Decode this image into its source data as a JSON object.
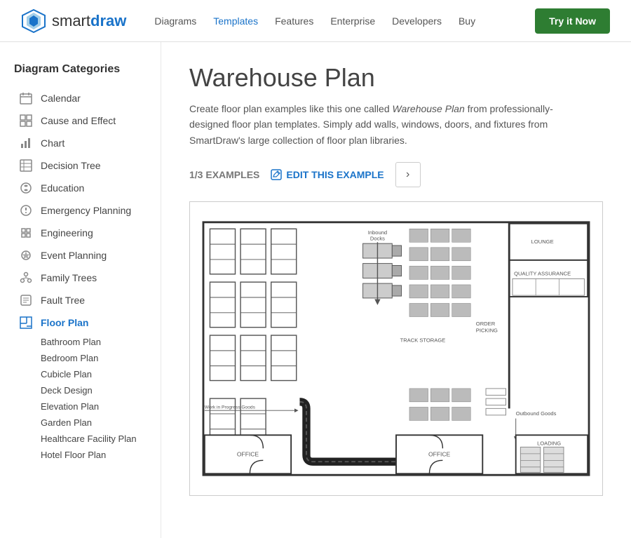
{
  "header": {
    "logo_smart": "smart",
    "logo_draw": "draw",
    "nav": [
      {
        "label": "Diagrams",
        "active": false
      },
      {
        "label": "Templates",
        "active": true
      },
      {
        "label": "Features",
        "active": false
      },
      {
        "label": "Enterprise",
        "active": false
      },
      {
        "label": "Developers",
        "active": false
      },
      {
        "label": "Buy",
        "active": false
      }
    ],
    "try_button": "Try it Now"
  },
  "sidebar": {
    "title": "Diagram Categories",
    "items": [
      {
        "label": "Calendar",
        "icon": "▦",
        "active": false
      },
      {
        "label": "Cause and Effect",
        "icon": "⊞",
        "active": false
      },
      {
        "label": "Chart",
        "icon": "▦",
        "active": false
      },
      {
        "label": "Decision Tree",
        "icon": "⊟",
        "active": false
      },
      {
        "label": "Education",
        "icon": "✿",
        "active": false
      },
      {
        "label": "Emergency Planning",
        "icon": "⊛",
        "active": false
      },
      {
        "label": "Engineering",
        "icon": "▦",
        "active": false
      },
      {
        "label": "Event Planning",
        "icon": "✿",
        "active": false
      },
      {
        "label": "Family Trees",
        "icon": "⊞",
        "active": false
      },
      {
        "label": "Fault Tree",
        "icon": "▣",
        "active": false
      },
      {
        "label": "Floor Plan",
        "icon": "◩",
        "active": true
      }
    ],
    "sub_items": [
      "Bathroom Plan",
      "Bedroom Plan",
      "Cubicle Plan",
      "Deck Design",
      "Elevation Plan",
      "Garden Plan",
      "Healthcare Facility Plan",
      "Hotel Floor Plan"
    ]
  },
  "content": {
    "title": "Warehouse Plan",
    "description": "Create floor plan examples like this one called Warehouse Plan from professionally-designed floor plan templates. Simply add walls, windows, doors, and fixtures from SmartDraw's large collection of floor plan libraries.",
    "example_counter": "1/3 EXAMPLES",
    "edit_label": "EDIT THIS EXAMPLE",
    "next_label": "›"
  }
}
